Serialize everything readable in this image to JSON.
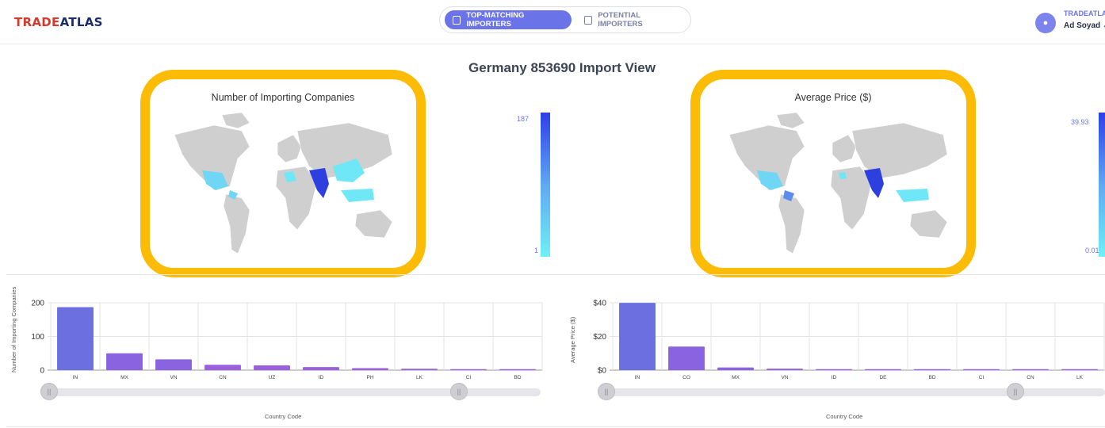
{
  "header": {
    "logo_part1": "TRADE",
    "logo_part2": "ATLAS",
    "tabs": [
      {
        "label": "TOP-MATCHING IMPORTERS",
        "active": true
      },
      {
        "label": "POTENTIAL IMPORTERS",
        "active": false
      }
    ],
    "user": {
      "company": "TRADEATLAS",
      "name": "Ad Soyad ⌄"
    }
  },
  "page_title": "Germany 853690 Import View",
  "maps": [
    {
      "title": "Number of Importing Companies",
      "scale_max": "187",
      "scale_min": "1"
    },
    {
      "title": "Average Price ($)",
      "scale_max": "39.93",
      "scale_min": "0.01"
    }
  ],
  "colors": {
    "accent": "#6b73e8",
    "highlight": "#fcbb05",
    "bar_blue": "#6b6fe0",
    "bar_purple": "#9b5fe0"
  },
  "chart_data": [
    {
      "type": "bar",
      "categories": [
        "IN",
        "MX",
        "VN",
        "CN",
        "UZ",
        "ID",
        "PH",
        "LK",
        "CI",
        "BD"
      ],
      "values": [
        187,
        50,
        32,
        16,
        14,
        9,
        6,
        4,
        2,
        2
      ],
      "ylabel": "Number of Importing Companies",
      "xlabel": "Country Code",
      "yticks": [
        "0",
        "100",
        "200"
      ],
      "ylim": [
        0,
        200
      ]
    },
    {
      "type": "bar",
      "categories": [
        "IN",
        "CO",
        "MX",
        "VN",
        "ID",
        "DE",
        "BD",
        "CI",
        "CN",
        "LK"
      ],
      "values": [
        39.93,
        14.0,
        1.6,
        0.9,
        0.3,
        0.2,
        0.05,
        0.02,
        0.01,
        0.01
      ],
      "ylabel": "Average Price ($)",
      "xlabel": "Country Code",
      "yticks": [
        "$0",
        "$20",
        "$40"
      ],
      "ylim": [
        0,
        40
      ]
    }
  ]
}
